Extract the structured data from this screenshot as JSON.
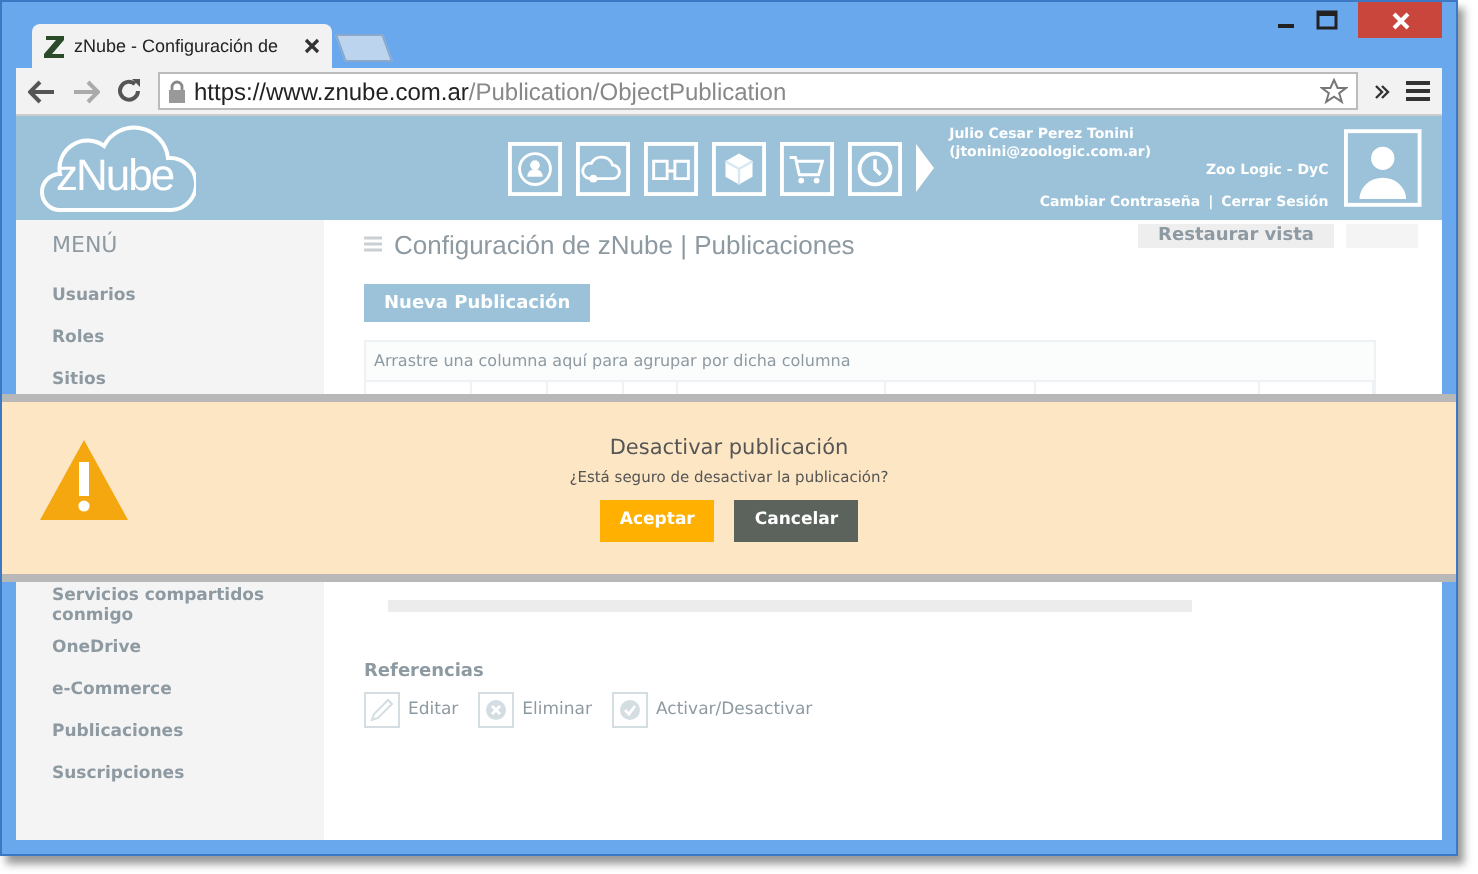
{
  "browser": {
    "tab_title": "zNube - Configuración de",
    "url_host": "https://www.znube.com.ar",
    "url_path": "/Publication/ObjectPublication"
  },
  "header": {
    "logo": "zNube",
    "user": "Julio Cesar Perez Tonini (jtonini@zoologic.com.ar)",
    "company": "Zoo Logic - DyC",
    "change_password": "Cambiar Contraseña",
    "separator": "|",
    "logout": "Cerrar Sesión"
  },
  "sidebar": {
    "title": "MENÚ",
    "items": [
      {
        "label": "Usuarios"
      },
      {
        "label": "Roles"
      },
      {
        "label": "Sitios"
      },
      {
        "label": "Servicios compartidos conmigo"
      },
      {
        "label": "OneDrive"
      },
      {
        "label": "e-Commerce"
      },
      {
        "label": "Publicaciones"
      },
      {
        "label": "Suscripciones"
      }
    ]
  },
  "main": {
    "title": "Configuración de zNube | Publicaciones",
    "restore_button": "Restaurar vista",
    "new_button": "Nueva Publicación",
    "group_hint": "Arrastre una columna aquí para agrupar por dicha columna",
    "references_title": "Referencias",
    "references": [
      {
        "kind": "edit",
        "label": "Editar"
      },
      {
        "kind": "delete",
        "label": "Eliminar"
      },
      {
        "kind": "toggle",
        "label": "Activar/Desactivar"
      }
    ]
  },
  "dialog": {
    "title": "Desactivar publicación",
    "message": "¿Está seguro de desactivar la publicación?",
    "buttons": [
      {
        "kind": "primary",
        "label": "Aceptar"
      },
      {
        "kind": "secondary",
        "label": "Cancelar"
      }
    ]
  }
}
